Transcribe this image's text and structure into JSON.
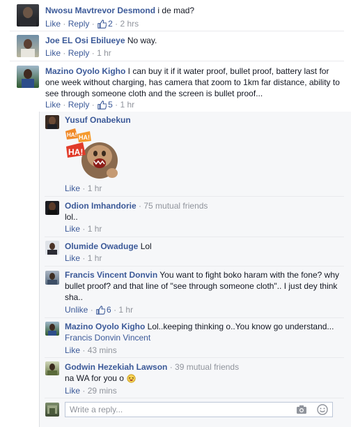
{
  "comments": [
    {
      "name": "Nwosu Mavtrevor Desmond",
      "text": "i de mad?",
      "like": "Like",
      "reply": "Reply",
      "likes": "2",
      "time": "2 hrs"
    },
    {
      "name": "Joe EL Osi Ebilueye",
      "text": "No way.",
      "like": "Like",
      "reply": "Reply",
      "time": "1 hr"
    },
    {
      "name": "Mazino Oyolo Kigho",
      "text": "I can buy it if it water proof, bullet proof, battery last for one week without charging, has camera that zoom to 1km far distance, ability to see through someone cloth and the screen is bullet proof...",
      "like": "Like",
      "reply": "Reply",
      "likes": "5",
      "time": "1 hr"
    }
  ],
  "replies": [
    {
      "name": "Yusuf Onabekun",
      "sticker_text": [
        "HA!",
        "HA!",
        "HA!"
      ],
      "like": "Like",
      "time": "1 hr"
    },
    {
      "name": "Odion Imhandorie",
      "mutual": "75 mutual friends",
      "text": "lol..",
      "like": "Like",
      "time": "1 hr"
    },
    {
      "name": "Olumide Owaduge",
      "text": "Lol",
      "like": "Like",
      "time": "1 hr"
    },
    {
      "name": "Francis Vincent Donvin",
      "text": "You want to fight boko haram with the fone? why bullet proof? and that line of \"see through someone cloth\".. I just dey think sha..",
      "like": "Unlike",
      "likes": "6",
      "time": "1 hr"
    },
    {
      "name": "Mazino Oyolo Kigho",
      "text": "Lol..keeping thinking o..You know go understand...",
      "tag": "Francis Donvin Vincent",
      "like": "Like",
      "time": "43 mins"
    },
    {
      "name": "Godwin Hezekiah Lawson",
      "mutual": "39 mutual friends",
      "text": "na WA for you o",
      "like": "Like",
      "time": "29 mins"
    }
  ],
  "reply_box": {
    "placeholder": "Write a reply..."
  },
  "separator": "·",
  "colors": {
    "link": "#3b5998",
    "muted": "#90949c",
    "background": "#ffffff",
    "reply_bg": "#f6f7f9"
  },
  "icons": [
    "like-thumb-icon",
    "camera-icon",
    "emoji-icon",
    "laughing-emoji-icon"
  ]
}
